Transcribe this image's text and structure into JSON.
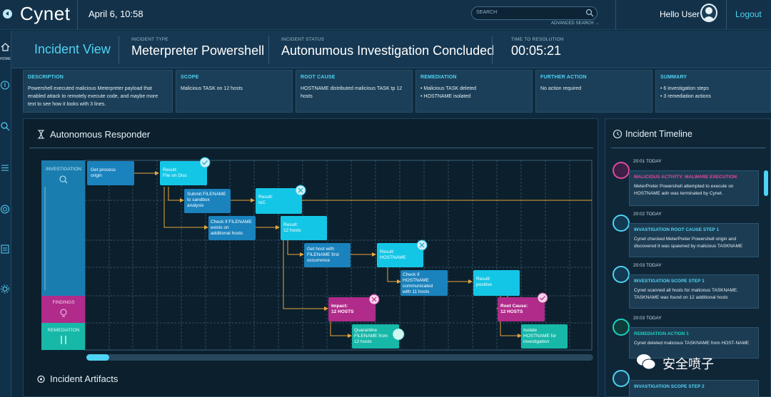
{
  "app": {
    "name": "Cynet",
    "datetime": "April 6, 10:58"
  },
  "search": {
    "placeholder": "SEARCH",
    "advanced": "ADVANCED SEARCH →"
  },
  "user": {
    "greeting": "Hello User",
    "logout": "Logout"
  },
  "sidebar": {
    "home_label": "HOME",
    "icons": [
      "home-icon",
      "compass-icon",
      "search-icon",
      "list-icon",
      "radar-icon",
      "report-icon",
      "settings-icon"
    ]
  },
  "header": {
    "view_title": "Incident View",
    "incident_type_label": "INCIDENT TYPE",
    "incident_type": "Meterpreter Powershell",
    "status_label": "INCIDENT STATUS",
    "status": "Autonumous Investigation Concluded",
    "ttr_label": "TIME TO RESOLUTION",
    "ttr": "00:05:21"
  },
  "cards": [
    {
      "title": "DESCRIPTION",
      "body": "Powershell executed malicious Meterpreter payload that enabled attack to remotely execute code, and maybe more text to see how it looks with 3 lines."
    },
    {
      "title": "SCOPE",
      "body": "Malicious TASK on 12 hosts"
    },
    {
      "title": "ROOT CAUSE",
      "body": "HOSTNAME distributed malicious TASK tp 12 hosts"
    },
    {
      "title": "REMEDIATION",
      "body": "• Malicious TASK deleted\n• HOSTNAME isolated"
    },
    {
      "title": "FURTHER ACTION",
      "body": "No action required"
    },
    {
      "title": "SUMMARY",
      "body": "• 6 investigation steps\n• 3 remediation actions"
    }
  ],
  "responder": {
    "title": "Autonomous Responder",
    "lanes": {
      "investigation": "INVESTIGATION",
      "findings": "FINDINGS",
      "remediation": "REMEDIATION"
    },
    "nodes": {
      "get_process": "Get process\norigin",
      "result_file": "Result:\nFile on Disc",
      "submit_file": "Submit FILENAME\nto sandbox\nanalysis",
      "result_ioc": "Result:\nIoC",
      "check_file": "Check if FILENAME\nexists on\nadditional hosts",
      "result_12": "Result:\n12 hosts",
      "get_host": "Get host with\nFILENAME first\noccurrence",
      "result_hostname": "Result:\nHOSTNAME",
      "check_hostname": "Check if\nHOSTNAME\ncommunicated\nwith 11 hosts",
      "result_positive": "Result:\npositive",
      "impact": "Impact:\n12 HOSTS",
      "root_cause": "Root Cause:\n12 HOSTS",
      "quarantine": "Quarantine\nFILENAME from\n12 hosts",
      "isolate": "Isolate\nHOSTNAME for\ninvestigation"
    },
    "artifacts_title": "Incident Artifacts"
  },
  "timeline": {
    "title": "Incident Timeline",
    "items": [
      {
        "time": "20:01 TODAY",
        "title": "MALICIOUS ACTIVITY: MALWARE EXECUTION",
        "body": "MeterPreter Powershell attempted to execute on HOSTNAME adn was terminated by Cynet.",
        "color": "#e04a9c"
      },
      {
        "time": "20:02 TODAY",
        "title": "INVASTIGATION ROOT CAUSE STEP 1",
        "body": "Cynet checked MeterPreter Powershell origin and discovered  it was spawned by malicious TASKNAME",
        "color": "#4fd3f4"
      },
      {
        "time": "20:03 TODAY",
        "title": "INVESTIGATION SCOPE STEP 1",
        "body": "Cynet scanned all hosts for malicious TASKNAME. TASKNAME was found on 12 additional hosts",
        "color": "#4fd3f4"
      },
      {
        "time": "20:03 TODAY",
        "title": "REMEDIATION ACTION 1",
        "body": "Cynet deleted malicious TASKNAME from HOST-NAME",
        "color": "#19d3c0"
      },
      {
        "time": "",
        "title": "INVASTIGATION SCOPE STEP 2",
        "body": "",
        "color": "#4fd3f4"
      }
    ]
  },
  "watermark": {
    "text": "安全喷子"
  },
  "colors": {
    "accent": "#4fd3f4",
    "magenta": "#e04a9c",
    "teal": "#19d3c0",
    "orange": "#e8a63a"
  }
}
